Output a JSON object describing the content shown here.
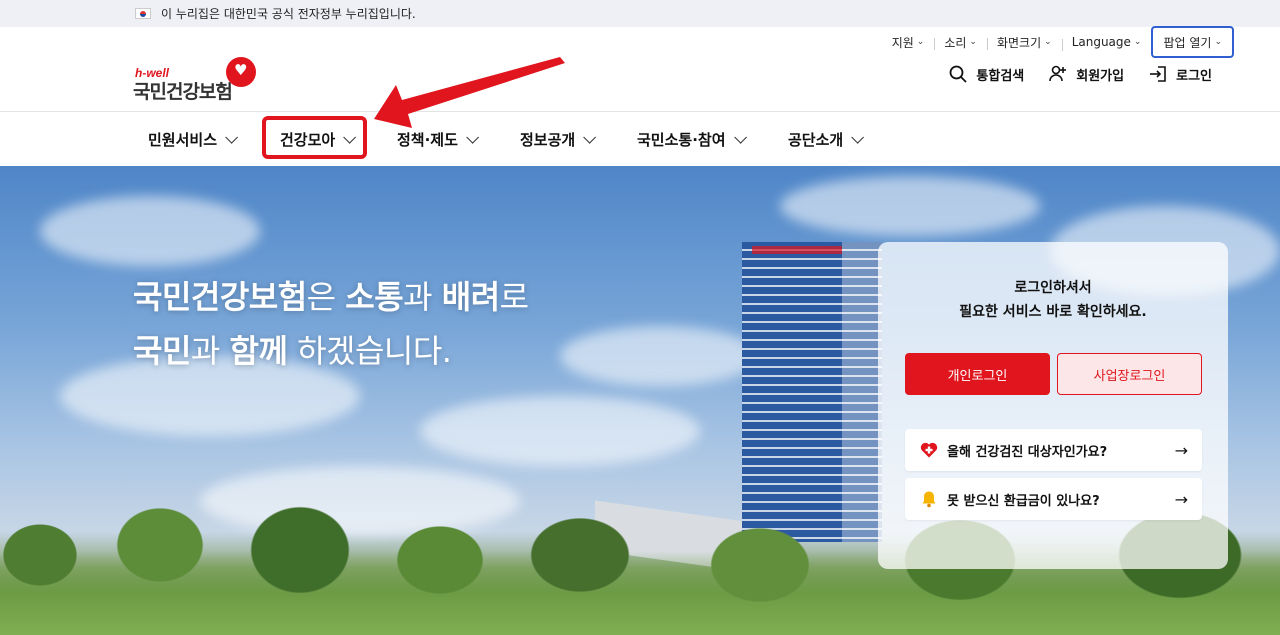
{
  "gov_banner": {
    "text": "이 누리집은 대한민국 공식 전자정부 누리집입니다."
  },
  "utility": [
    {
      "label": "지원"
    },
    {
      "label": "소리"
    },
    {
      "label": "화면크기"
    },
    {
      "label": "Language"
    },
    {
      "label": "팝업 열기"
    }
  ],
  "logo": {
    "tagline": "h-well",
    "name": "국민건강보험"
  },
  "actions": {
    "search": "통합검색",
    "signup": "회원가입",
    "login": "로그인"
  },
  "nav": [
    {
      "label": "민원서비스"
    },
    {
      "label": "건강모아"
    },
    {
      "label": "정책·제도"
    },
    {
      "label": "정보공개"
    },
    {
      "label": "국민소통·참여"
    },
    {
      "label": "공단소개"
    }
  ],
  "hero": {
    "line1": {
      "a": "국민건강보험",
      "b": "은 ",
      "c": "소통",
      "d": "과 ",
      "e": "배려",
      "f": "로"
    },
    "line2": {
      "a": "국민",
      "b": "과 ",
      "c": "함께",
      "d": " 하겠습니다."
    }
  },
  "login_panel": {
    "msg1": "로그인하셔서",
    "msg2": "필요한 서비스 바로 확인하세요.",
    "personal_login": "개인로그인",
    "business_login": "사업장로그인",
    "checkup": "올해 건강검진 대상자인가요?",
    "refund": "못 받으신 환급금이 있나요?",
    "arrow": "→"
  },
  "colors": {
    "brand_red": "#e0151d",
    "popup_outline": "#2f5fd0"
  }
}
